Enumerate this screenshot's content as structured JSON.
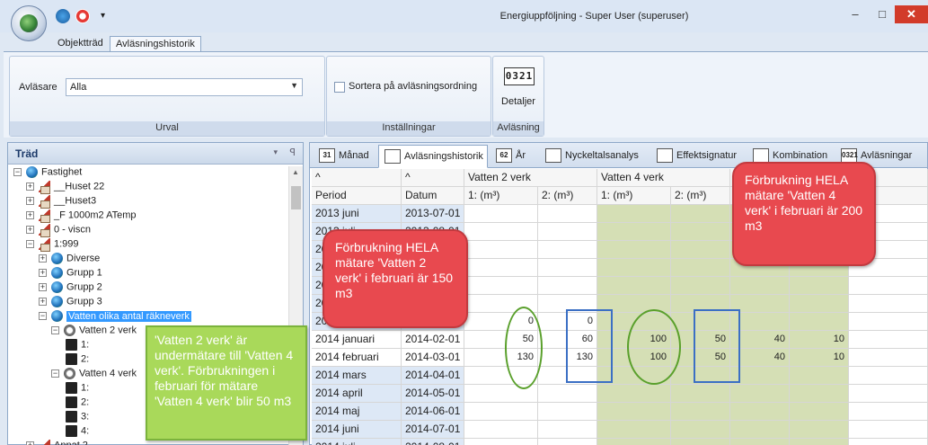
{
  "window": {
    "title": "Energiuppföljning - Super User (superuser)",
    "minimize": "–",
    "maximize": "□",
    "close": "✕",
    "quick_access_menu": "▾"
  },
  "ribbon": {
    "tabs": [
      "Objektträd",
      "Avläsningshistorik"
    ],
    "active_tab": "Avläsningshistorik",
    "urval": {
      "label": "Avläsare",
      "value": "Alla",
      "group_title": "Urval"
    },
    "installningar": {
      "checkbox_label": "Sortera på avläsningsordning",
      "checked": false,
      "group_title": "Inställningar"
    },
    "avlasning": {
      "icon_digits": "0321",
      "button_label": "Detaljer",
      "group_title": "Avläsning"
    }
  },
  "tree": {
    "title": "Träd",
    "dropdown": "▾",
    "pin": "ꟼ",
    "nodes": [
      {
        "label": "Fastighet",
        "expander": "−",
        "icon": "globe-icon"
      },
      {
        "label": "__Huset 22",
        "expander": "+",
        "icon": "house-icon"
      },
      {
        "label": "__Huset3",
        "expander": "+",
        "icon": "house-icon"
      },
      {
        "label": "_F 1000m2 ATemp",
        "expander": "+",
        "icon": "house-icon"
      },
      {
        "label": "0 - viscn",
        "expander": "+",
        "icon": "house-icon"
      },
      {
        "label": "1:999",
        "expander": "−",
        "icon": "house-icon"
      },
      {
        "label": "Diverse",
        "expander": "+",
        "icon": "globe-icon"
      },
      {
        "label": "Grupp 1",
        "expander": "+",
        "icon": "globe-icon"
      },
      {
        "label": "Grupp 2",
        "expander": "+",
        "icon": "globe-icon"
      },
      {
        "label": "Grupp 3",
        "expander": "+",
        "icon": "globe-icon"
      },
      {
        "label": "Vatten olika antal räkneverk",
        "expander": "−",
        "icon": "globe-icon",
        "selected": true
      },
      {
        "label": "Vatten 2 verk",
        "expander": "−",
        "icon": "meter-icon"
      },
      {
        "label": "1:",
        "icon": "register-icon"
      },
      {
        "label": "2:",
        "icon": "register-icon"
      },
      {
        "label": "Vatten 4 verk",
        "expander": "−",
        "icon": "meter-icon"
      },
      {
        "label": "1:",
        "icon": "register-icon"
      },
      {
        "label": "2:",
        "icon": "register-icon"
      },
      {
        "label": "3:",
        "icon": "register-icon"
      },
      {
        "label": "4:",
        "icon": "register-icon"
      },
      {
        "label": "Annat 2",
        "expander": "+",
        "icon": "house-icon"
      }
    ]
  },
  "content_tabs": [
    {
      "label": "Månad",
      "icon": "calendar-month-icon",
      "icon_text": "31"
    },
    {
      "label": "Avläsningshistorik",
      "icon": "table-icon",
      "icon_text": "",
      "active": true
    },
    {
      "label": "År",
      "icon": "calendar-year-icon",
      "icon_text": "62"
    },
    {
      "label": "Nyckeltalsanalys",
      "icon": "keys-icon",
      "icon_text": ""
    },
    {
      "label": "Effektsignatur",
      "icon": "scatter-icon",
      "icon_text": ""
    },
    {
      "label": "Kombination",
      "icon": "bar-chart-icon",
      "icon_text": ""
    },
    {
      "label": "Avläsningar",
      "icon": "counter-icon",
      "icon_text": "0321"
    }
  ],
  "grid": {
    "sort_markers": [
      "^",
      "^"
    ],
    "group_headers": [
      "Vatten 2 verk",
      "Vatten 4 verk"
    ],
    "columns": [
      "Period",
      "Datum",
      "1: (m³)",
      "2: (m³)",
      "1: (m³)",
      "2: (m³)"
    ],
    "rows": [
      {
        "period": "2013 juni",
        "datum": "2013-07-01",
        "values": [
          "",
          "",
          "",
          "",
          "",
          ""
        ]
      },
      {
        "period": "2013 juli",
        "datum": "2013-08-01",
        "values": [
          "",
          "",
          "",
          "",
          "",
          ""
        ]
      },
      {
        "period": "2013 augusti",
        "datum": "2013-09-01",
        "values": [
          "",
          "",
          "",
          "",
          "",
          ""
        ]
      },
      {
        "period": "2013 september",
        "datum": "2013-10-01",
        "values": [
          "",
          "",
          "",
          "",
          "",
          ""
        ]
      },
      {
        "period": "2013 oktober",
        "datum": "2013-11-01",
        "values": [
          "",
          "",
          "",
          "",
          "",
          ""
        ]
      },
      {
        "period": "2013 november",
        "datum": "2013-12-01",
        "values": [
          "",
          "",
          "",
          "",
          "",
          ""
        ]
      },
      {
        "period": "2013 december",
        "datum": "2014-01-01",
        "values": [
          "0",
          "0",
          "",
          "",
          "",
          ""
        ]
      },
      {
        "period": "2014 januari",
        "datum": "2014-02-01",
        "values": [
          "50",
          "60",
          "100",
          "50",
          "40",
          "10"
        ]
      },
      {
        "period": "2014 februari",
        "datum": "2014-03-01",
        "values": [
          "130",
          "130",
          "100",
          "50",
          "40",
          "10"
        ]
      },
      {
        "period": "2014 mars",
        "datum": "2014-04-01",
        "values": [
          "",
          "",
          "",
          "",
          "",
          ""
        ]
      },
      {
        "period": "2014 april",
        "datum": "2014-05-01",
        "values": [
          "",
          "",
          "",
          "",
          "",
          ""
        ]
      },
      {
        "period": "2014 maj",
        "datum": "2014-06-01",
        "values": [
          "",
          "",
          "",
          "",
          "",
          ""
        ]
      },
      {
        "period": "2014 juni",
        "datum": "2014-07-01",
        "values": [
          "",
          "",
          "",
          "",
          "",
          ""
        ]
      },
      {
        "period": "2014 juli",
        "datum": "2014-08-01",
        "values": [
          "",
          "",
          "",
          "",
          "",
          ""
        ]
      }
    ]
  },
  "annotations": {
    "red_left": "Förbrukning HELA mätare 'Vatten 2 verk' i februari är 150 m3",
    "red_right": "Förbrukning HELA mätare 'Vatten 4 verk' i februari är 200 m3",
    "green": "'Vatten 2 verk' är undermätare till 'Vatten 4 verk'. Förbrukningen i februari för mätare 'Vatten 4 verk' blir 50 m3"
  },
  "colors": {
    "accent": "#3399ff",
    "green_column": "#d5dfb5",
    "callout_red": "#e8494f",
    "callout_green": "#a9d95a",
    "highlight_blue": "#3b6fc4",
    "highlight_green": "#5aa02c"
  }
}
